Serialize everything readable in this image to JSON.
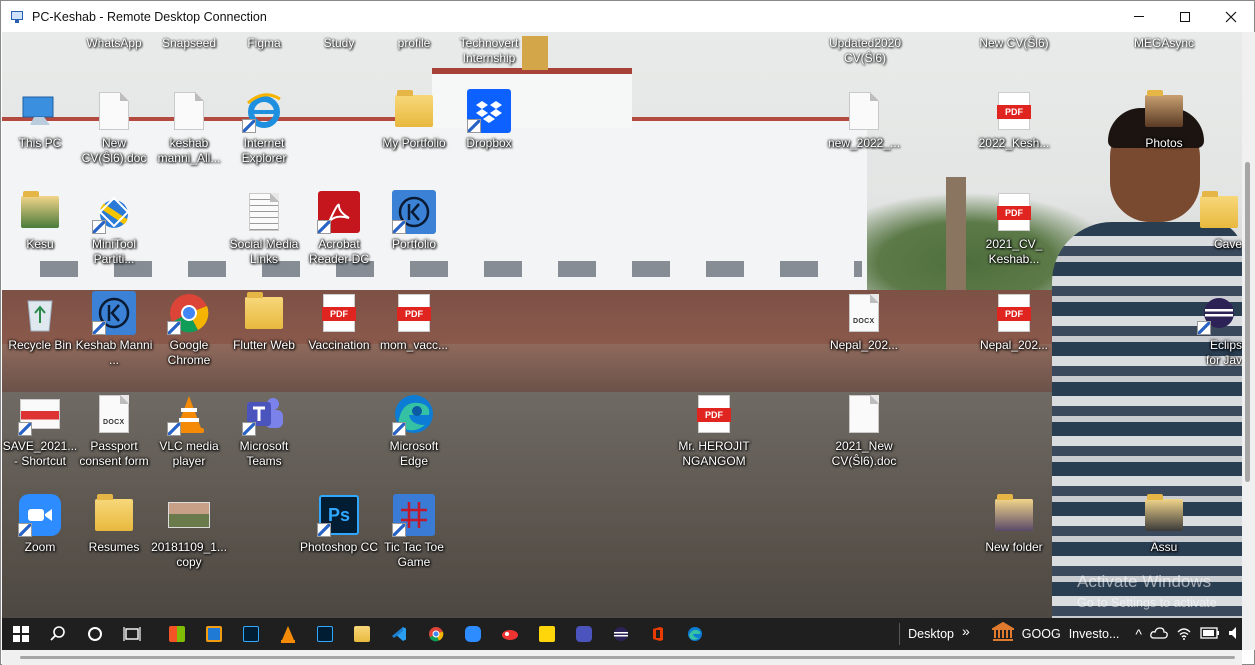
{
  "window": {
    "title": "PC-Keshab - Remote Desktop Connection"
  },
  "top_labels": [
    "WhatsApp",
    "Snapseed",
    "Figma",
    "Study",
    "profile",
    "Technovert Internship",
    "Updated2020 CV(Ŝl6)",
    "New CV(Ŝl6)",
    "MEGAsync"
  ],
  "desktop_icons": [
    {
      "label": "This PC"
    },
    {
      "label": "New CV(Ŝl6).doc"
    },
    {
      "label": "keshab manni_All..."
    },
    {
      "label": "Internet Explorer"
    },
    {
      "label": "My Portfolio"
    },
    {
      "label": "Dropbox"
    },
    {
      "label": "new_2022_..."
    },
    {
      "label": "2022_Kesh..."
    },
    {
      "label": "Photos"
    },
    {
      "label": "Kesu"
    },
    {
      "label": "MiniTool Partiti..."
    },
    {
      "label": "Social Media Links"
    },
    {
      "label": "Acrobat Reader DC"
    },
    {
      "label": "Portfolio"
    },
    {
      "label": "2021_CV_ Keshab..."
    },
    {
      "label": "Cave"
    },
    {
      "label": "Recycle Bin"
    },
    {
      "label": "Keshab Manni ..."
    },
    {
      "label": "Google Chrome"
    },
    {
      "label": "Flutter Web"
    },
    {
      "label": "Vaccination"
    },
    {
      "label": "mom_vacc..."
    },
    {
      "label": "Nepal_202..."
    },
    {
      "label": "Nepal_202..."
    },
    {
      "label": "Eclips for Jav"
    },
    {
      "label": "SAVE_2021... - Shortcut"
    },
    {
      "label": "Passport consent form"
    },
    {
      "label": "VLC media player"
    },
    {
      "label": "Microsoft Teams"
    },
    {
      "label": "Microsoft Edge"
    },
    {
      "label": "Mr. HEROJIT NGANGOM"
    },
    {
      "label": "2021_New CV(Ŝl6).doc"
    },
    {
      "label": "Zoom"
    },
    {
      "label": "Resumes"
    },
    {
      "label": "20181109_1... copy"
    },
    {
      "label": "Photoshop CC"
    },
    {
      "label": "Tic Tac Toe Game"
    },
    {
      "label": "New folder"
    },
    {
      "label": "Assu"
    }
  ],
  "watermark": {
    "line1": "Activate Windows",
    "line2": "Go to Settings to activate"
  },
  "taskbar": {
    "desktop_label": "Desktop",
    "chevron": "»",
    "stock_label": "GOOG",
    "news_label": "Investo...",
    "up_arrow": "^"
  },
  "badges": {
    "docx": "DOCX",
    "pdf": "PDF"
  }
}
